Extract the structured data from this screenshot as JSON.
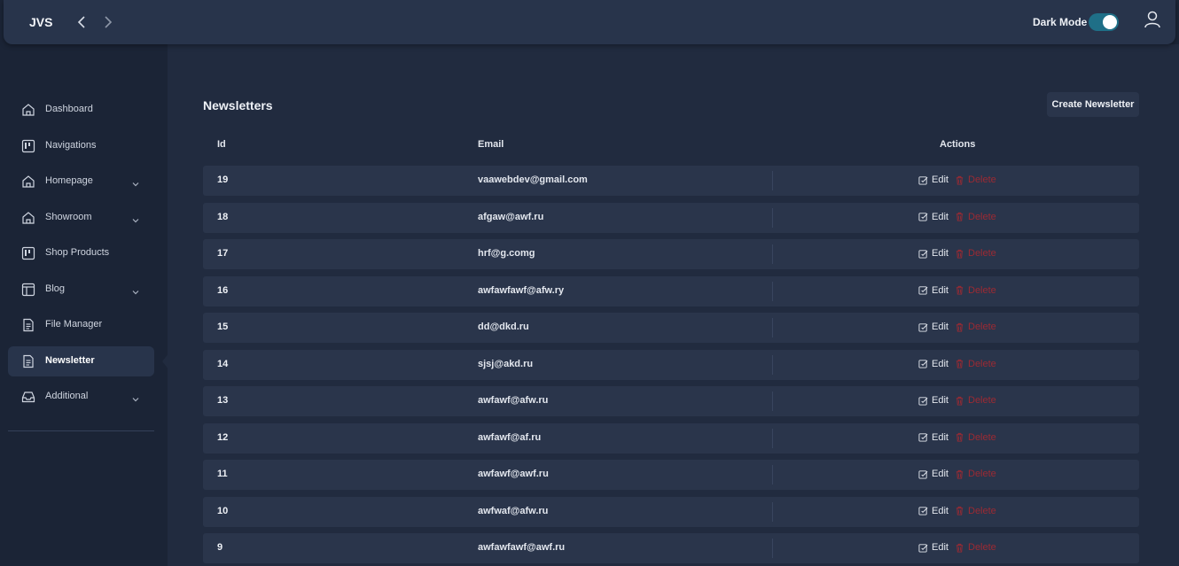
{
  "header": {
    "brand": "JVS",
    "dark_mode_label": "Dark Mode",
    "dark_mode_on": true,
    "icons": {
      "back": "chevron-left-icon",
      "forward": "chevron-right-icon",
      "user": "user-icon"
    }
  },
  "sidebar": {
    "items": [
      {
        "label": "Dashboard",
        "icon": "home-icon",
        "has_submenu": false,
        "active": false
      },
      {
        "label": "Navigations",
        "icon": "kanban-icon",
        "has_submenu": false,
        "active": false
      },
      {
        "label": "Homepage",
        "icon": "home-icon",
        "has_submenu": true,
        "active": false
      },
      {
        "label": "Showroom",
        "icon": "home-icon",
        "has_submenu": true,
        "active": false
      },
      {
        "label": "Shop Products",
        "icon": "kanban-icon",
        "has_submenu": false,
        "active": false
      },
      {
        "label": "Blog",
        "icon": "layout-icon",
        "has_submenu": true,
        "active": false
      },
      {
        "label": "File Manager",
        "icon": "document-icon",
        "has_submenu": false,
        "active": false
      },
      {
        "label": "Newsletter",
        "icon": "document-icon",
        "has_submenu": false,
        "active": true
      },
      {
        "label": "Additional",
        "icon": "inbox-icon",
        "has_submenu": true,
        "active": false
      }
    ]
  },
  "main": {
    "title": "Newsletters",
    "create_button": "Create Newsletter",
    "columns": {
      "id": "Id",
      "email": "Email",
      "actions": "Actions"
    },
    "edit_label": "Edit",
    "delete_label": "Delete",
    "rows": [
      {
        "id": "19",
        "email": "vaawebdev@gmail.com"
      },
      {
        "id": "18",
        "email": "afgaw@awf.ru"
      },
      {
        "id": "17",
        "email": "hrf@g.comg"
      },
      {
        "id": "16",
        "email": "awfawfawf@afw.ry"
      },
      {
        "id": "15",
        "email": "dd@dkd.ru"
      },
      {
        "id": "14",
        "email": "sjsj@akd.ru"
      },
      {
        "id": "13",
        "email": "awfawf@afw.ru"
      },
      {
        "id": "12",
        "email": "awfawf@af.ru"
      },
      {
        "id": "11",
        "email": "awfawf@awf.ru"
      },
      {
        "id": "10",
        "email": "awfwaf@afw.ru"
      },
      {
        "id": "9",
        "email": "awfawfawf@awf.ru"
      }
    ]
  },
  "colors": {
    "accent_toggle": "#1f6f87",
    "delete_red": "#9c2a33",
    "panel": "#28344b",
    "background": "#1b2436"
  }
}
